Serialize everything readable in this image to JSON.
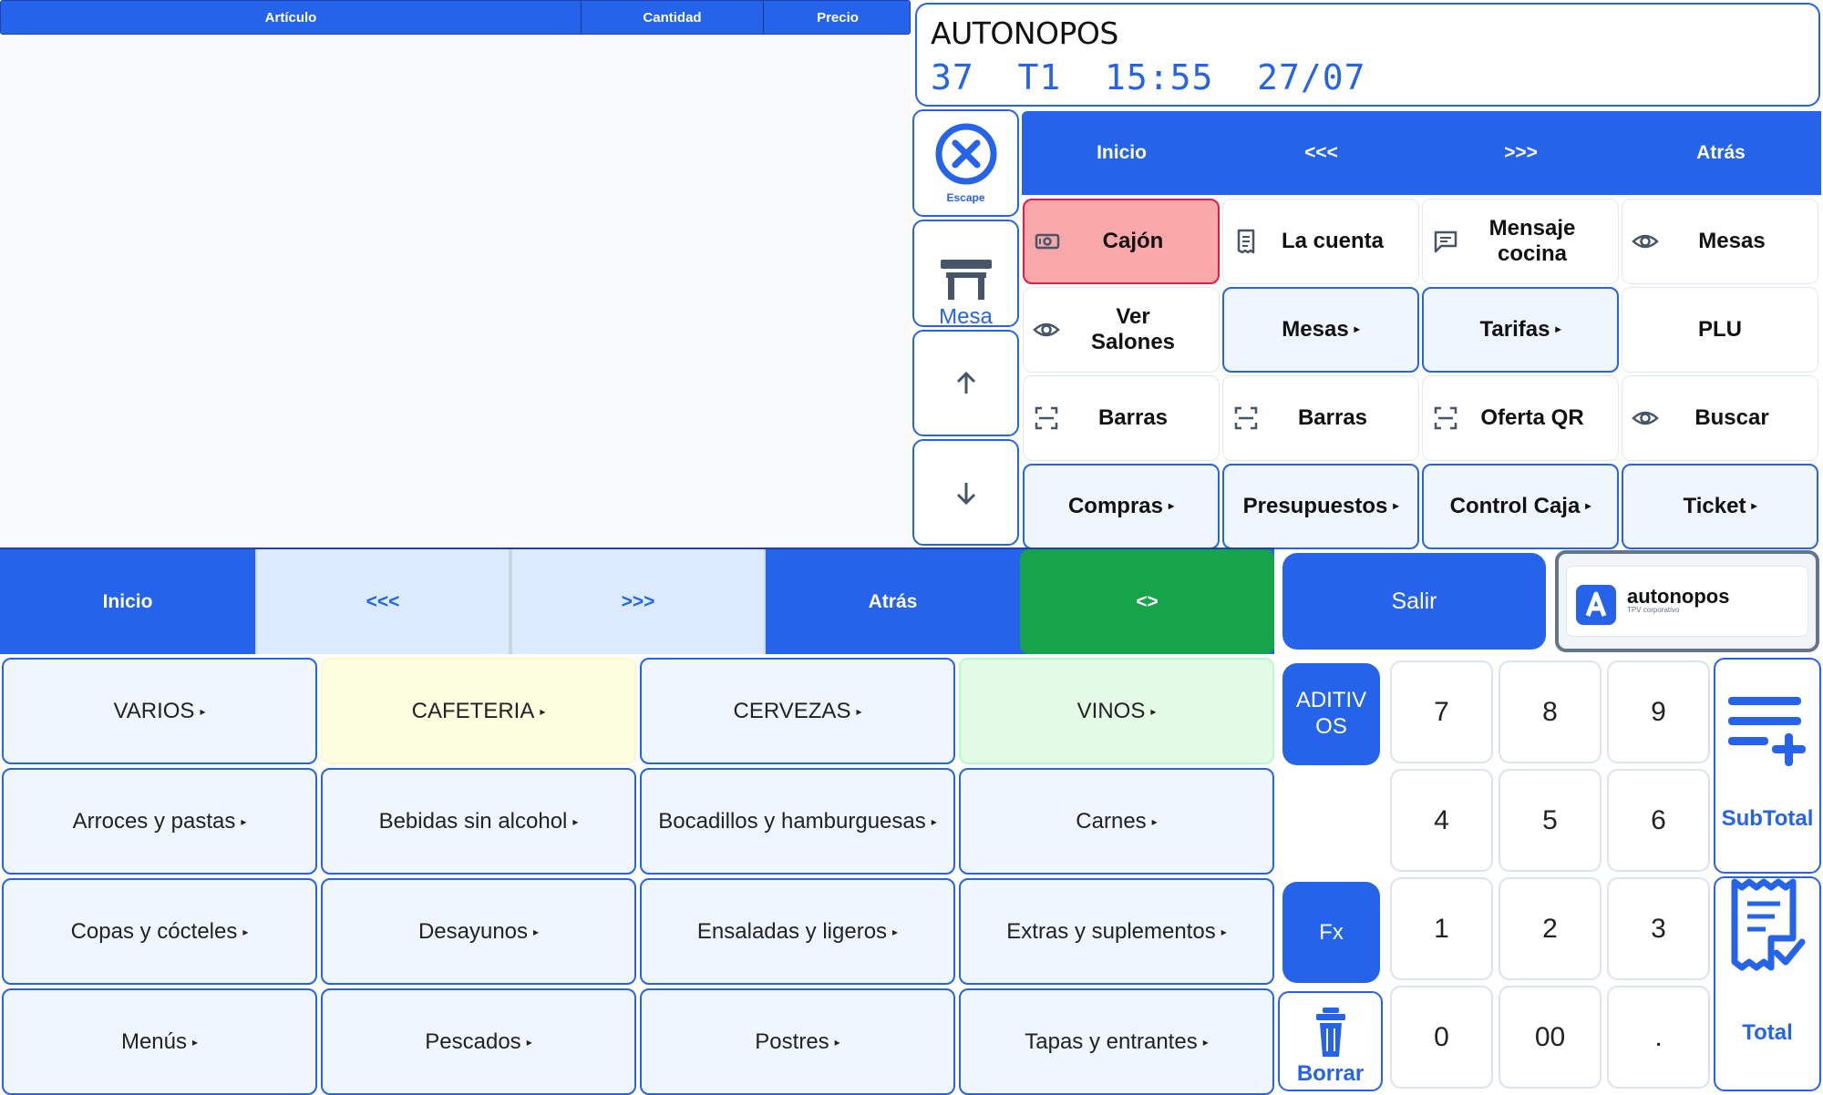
{
  "ticket": {
    "headers": [
      "Artículo",
      "Cantidad",
      "Precio"
    ]
  },
  "display": {
    "title": "AUTONOPOS",
    "info": "37  T1  15:55  27/07"
  },
  "side": {
    "escape": "Escape",
    "mesa": "Mesa"
  },
  "topnav": [
    "Inicio",
    "<<<",
    ">>>",
    "Atrás"
  ],
  "functions": [
    {
      "label": "Cajón",
      "icon": "cash-drawer-icon"
    },
    {
      "label": "La cuenta",
      "icon": "receipt-icon"
    },
    {
      "label": "Mensaje cocina",
      "icon": "message-icon"
    },
    {
      "label": "Mesas",
      "icon": "eye-icon"
    },
    {
      "label": "Ver Salones",
      "icon": "eye-icon"
    },
    {
      "label": "Mesas",
      "submenu": true
    },
    {
      "label": "Tarifas",
      "submenu": true
    },
    {
      "label": "PLU"
    },
    {
      "label": "Barras",
      "icon": "scan-icon"
    },
    {
      "label": "Barras",
      "icon": "scan-icon"
    },
    {
      "label": "Oferta QR",
      "icon": "scan-icon"
    },
    {
      "label": "Buscar",
      "icon": "eye-icon"
    },
    {
      "label": "Compras",
      "submenu": true
    },
    {
      "label": "Presupuestos",
      "submenu": true
    },
    {
      "label": "Control Caja",
      "submenu": true
    },
    {
      "label": "Ticket",
      "submenu": true
    }
  ],
  "bottomnav": [
    "Inicio",
    "<<<",
    ">>>",
    "Atrás",
    "<>"
  ],
  "salir": "Salir",
  "brand": {
    "name": "autonopos",
    "tagline": "TPV corporativo"
  },
  "categories": [
    "VARIOS",
    "CAFETERIA",
    "CERVEZAS",
    "VINOS",
    "Arroces y pastas",
    "Bebidas sin alcohol",
    "Bocadillos y hamburguesas",
    "Carnes",
    "Copas y cócteles",
    "Desayunos",
    "Ensaladas y ligeros",
    "Extras y suplementos",
    "Menús",
    "Pescados",
    "Postres",
    "Tapas y entrantes"
  ],
  "keypad": {
    "aditivos": "ADITIV OS",
    "fx": "Fx",
    "borrar": "Borrar",
    "keys": [
      "7",
      "8",
      "9",
      "4",
      "5",
      "6",
      "1",
      "2",
      "3",
      "0",
      "00",
      "."
    ],
    "subtotal": "SubTotal",
    "total": "Total"
  },
  "colors": {
    "primary": "#2563eb",
    "green": "#16a34a",
    "drawer": "#f8a8a8"
  }
}
